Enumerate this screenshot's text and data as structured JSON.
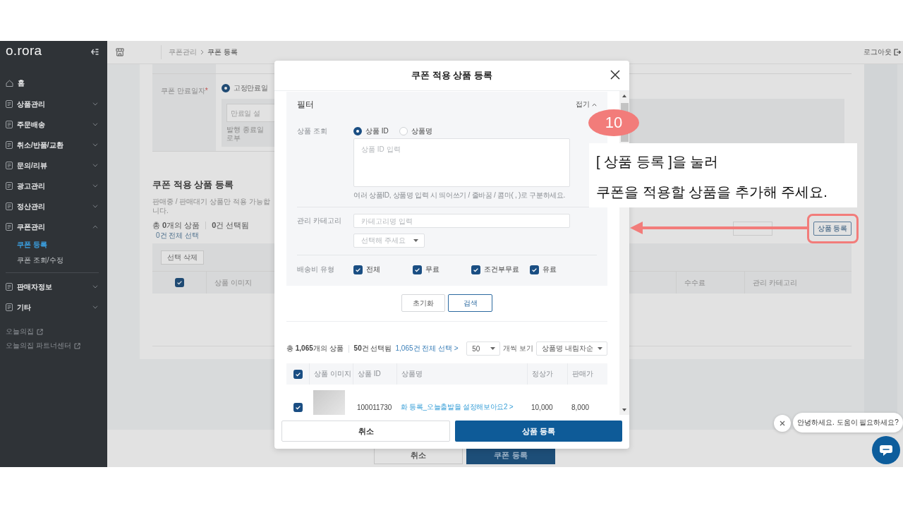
{
  "sidebar": {
    "logo": "o.rora",
    "home": "홈",
    "menu": [
      {
        "label": "상품관리",
        "expanded": false
      },
      {
        "label": "주문배송",
        "expanded": false
      },
      {
        "label": "취소/반품/교환",
        "expanded": false
      },
      {
        "label": "문의/리뷰",
        "expanded": false
      },
      {
        "label": "광고관리",
        "expanded": false
      },
      {
        "label": "정산관리",
        "expanded": false
      },
      {
        "label": "쿠폰관리",
        "expanded": true,
        "children": [
          {
            "label": "쿠폰 등록",
            "selected": true
          },
          {
            "label": "쿠폰 조회/수정",
            "selected": false
          }
        ]
      }
    ],
    "menu_more": [
      {
        "label": "판매자정보",
        "expanded": false
      },
      {
        "label": "기타",
        "expanded": false
      }
    ],
    "links": [
      "오늘의집",
      "오늘의집 파트너센터"
    ]
  },
  "top_bar": {
    "breadcrumb": [
      {
        "label": "쿠폰관리",
        "current": false
      },
      {
        "label": "쿠폰 등록",
        "current": true
      }
    ],
    "logout": "로그아웃"
  },
  "page": {
    "expiry": {
      "label": "쿠폰 만료일자",
      "required_mark": "*",
      "option": {
        "label": "고정만료일",
        "selected": true
      },
      "placeholder": "만료일 설",
      "hint": "발행 종료일로부"
    },
    "products": {
      "title": "쿠폰 적용 상품 등록",
      "note": "판매중 / 판매대기 상품만 적용 가능합니다.",
      "total": "총 **0**개의 상품",
      "selected_count": "**0**건 선택됨",
      "select_all": "0건 전체 선택",
      "add_button": "상품 등록",
      "delete_button": "선택 삭제",
      "header_checked": true,
      "columns": [
        "상품 이미지",
        "수수료",
        "관리 카테고리"
      ]
    },
    "footer_buttons": [
      {
        "label": "취소",
        "kind": "secondary"
      },
      {
        "label": "쿠폰 등록",
        "kind": "primary"
      }
    ]
  },
  "modal": {
    "title": "쿠폰 적용 상품 등록",
    "filter": {
      "title": "필터",
      "collapse": "접기",
      "search_label": "상품 조회",
      "search_modes": [
        {
          "label": "상품 ID",
          "selected": true
        },
        {
          "label": "상품명",
          "selected": false
        }
      ],
      "placeholder": "상품 ID 입력",
      "hint": "여러 상품ID, 상품명 입력 시 띄어쓰기 / 줄바꿈 / 콤마( , )로 구분하세요.",
      "category_label": "관리 카테고리",
      "category_placeholder": "카테고리명 입력",
      "category_select": "선택해 주세요",
      "shipping_label": "배송비 유형",
      "shipping_types": [
        {
          "label": "전체",
          "checked": true
        },
        {
          "label": "무료",
          "checked": true
        },
        {
          "label": "조건부무료",
          "checked": true
        },
        {
          "label": "유료",
          "checked": true
        }
      ]
    },
    "reset_button": "초기화",
    "search_button": "검색",
    "summary": {
      "total": "총 **1,065**개의 상품",
      "selected_count": "**50**건 선택됨",
      "select_all": "1,065건 전체 선택 >",
      "page_size": "50",
      "page_size_label": "개씩 보기",
      "sort": "상품명 내림차순"
    },
    "table": {
      "header_checked": true,
      "columns": [
        "상품 이미지",
        "상품 ID",
        "상품명",
        "정상가",
        "판매가"
      ],
      "rows": [
        {
          "checked": true,
          "id": "100011730",
          "name": "화 등록_오늘출발을 설정해보아요2 >",
          "price": "10,000",
          "sale_price": "8,000"
        }
      ]
    },
    "cancel_button": "취소",
    "submit_button": "상품 등록"
  },
  "guide": {
    "step": "10",
    "lines": [
      "[ 상품 등록 ]을 눌러",
      "쿠폰을 적용할 상품을 추가해 주세요."
    ]
  },
  "chat": {
    "greeting": "안녕하세요. 도움이 필요하세요?"
  }
}
